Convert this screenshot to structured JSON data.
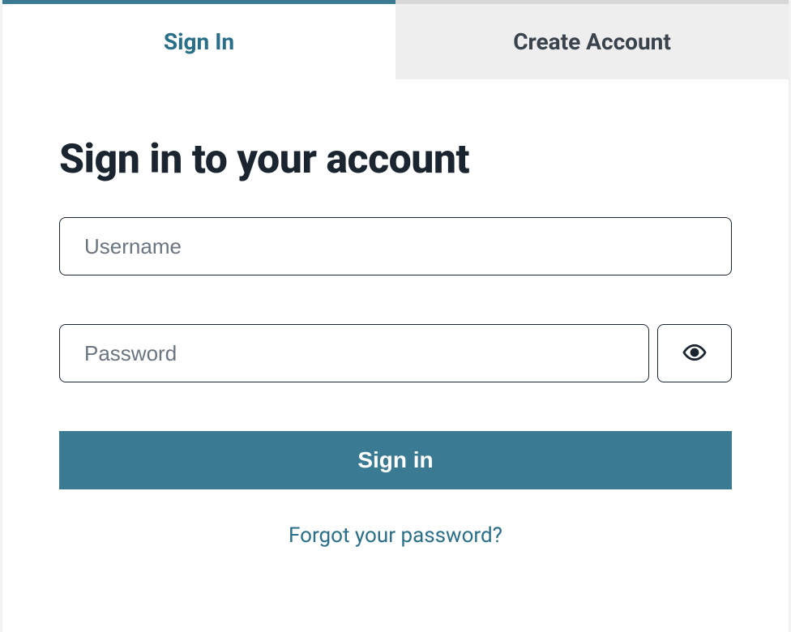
{
  "tabs": {
    "signin_label": "Sign In",
    "create_label": "Create Account"
  },
  "heading": "Sign in to your account",
  "form": {
    "username_placeholder": "Username",
    "username_value": "",
    "password_placeholder": "Password",
    "password_value": "",
    "submit_label": "Sign in"
  },
  "forgot_link": "Forgot your password?",
  "colors": {
    "accent": "#3a7a93",
    "text_dark": "#1a2530",
    "link": "#2a6f8a",
    "inactive_bg": "#eeeeee"
  }
}
